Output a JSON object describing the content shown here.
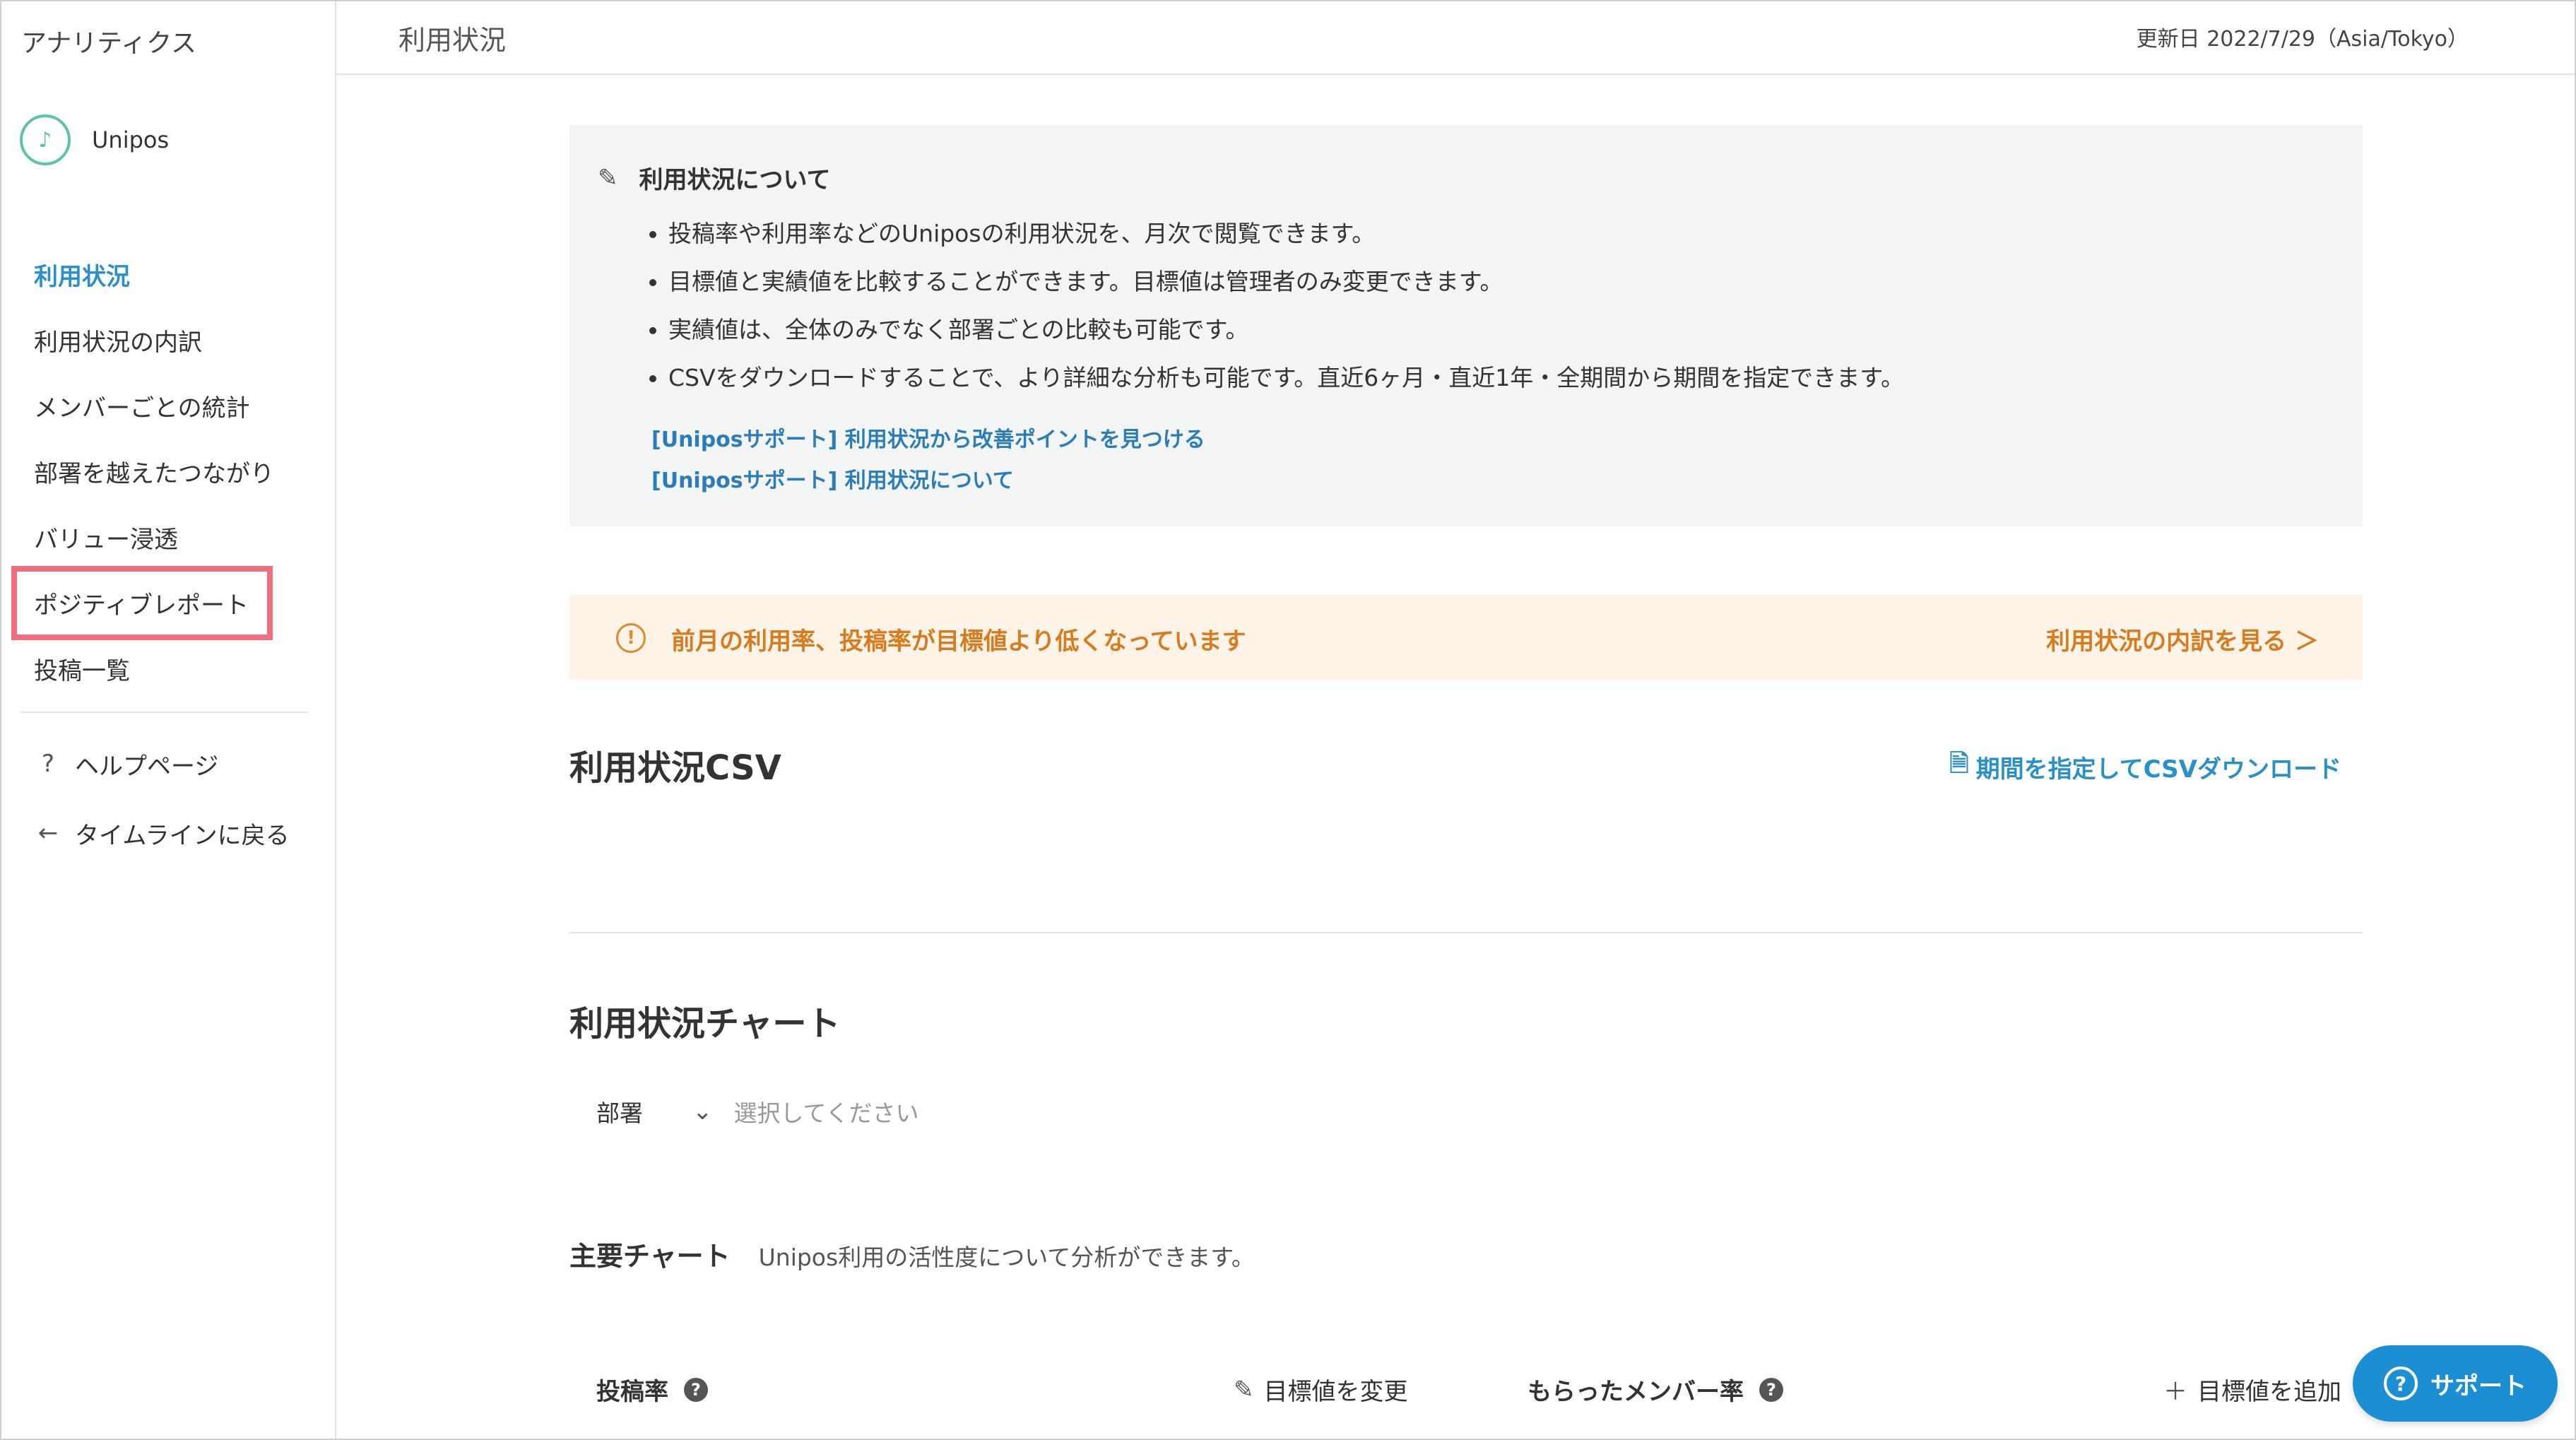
{
  "sidebar": {
    "app_title": "アナリティクス",
    "org_name": "Unipos",
    "nav": [
      {
        "label": "利用状況"
      },
      {
        "label": "利用状況の内訳"
      },
      {
        "label": "メンバーごとの統計"
      },
      {
        "label": "部署を越えたつながり"
      },
      {
        "label": "バリュー浸透"
      },
      {
        "label": "ポジティブレポート"
      },
      {
        "label": "投稿一覧"
      }
    ],
    "help": {
      "icon": "?",
      "label": "ヘルプページ"
    },
    "back": {
      "icon": "←",
      "label": "タイムラインに戻る"
    }
  },
  "header": {
    "title": "利用状況",
    "updated": "更新日 2022/7/29（Asia/Tokyo）"
  },
  "info": {
    "title": "利用状況について",
    "bullets": [
      "投稿率や利用率などのUniposの利用状況を、月次で閲覧できます。",
      "目標値と実績値を比較することができます。目標値は管理者のみ変更できます。",
      "実績値は、全体のみでなく部署ごとの比較も可能です。",
      "CSVをダウンロードすることで、より詳細な分析も可能です。直近6ヶ月・直近1年・全期間から期間を指定できます。"
    ],
    "links": [
      "[Uniposサポート] 利用状況から改善ポイントを見つける",
      "[Uniposサポート] 利用状況について"
    ]
  },
  "alert": {
    "icon": "!",
    "text": "前月の利用率、投稿率が目標値より低くなっています",
    "link": "利用状況の内訳を見る ＞"
  },
  "csv": {
    "title": "利用状況CSV",
    "download": "期間を指定してCSVダウンロード"
  },
  "chart_section": {
    "title": "利用状況チャート",
    "dept_label": "部署",
    "dept_placeholder": "選択してください"
  },
  "main_chart": {
    "title": "主要チャート",
    "desc": "Unipos利用の活性度について分析ができます。"
  },
  "metrics": {
    "post_rate": "投稿率",
    "edit_target": "目標値を変更",
    "received_rate": "もらったメンバー率",
    "add_target": "目標値を追加"
  },
  "support": {
    "label": "サポート"
  },
  "colors": {
    "accent": "#2a90c9",
    "warning": "#d87b1f",
    "highlight": "#f26d7d",
    "support": "#1c8fd4"
  }
}
